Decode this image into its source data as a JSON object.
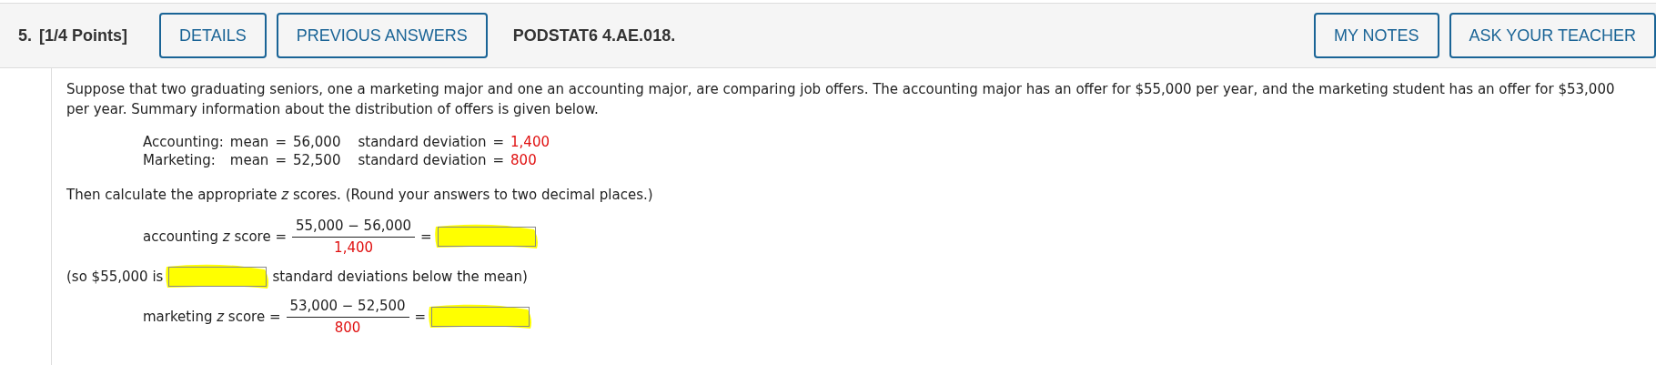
{
  "header": {
    "number": "5.",
    "points": "[1/4 Points]",
    "left_buttons": [
      {
        "label": "DETAILS"
      },
      {
        "label": "PREVIOUS ANSWERS"
      }
    ],
    "code": "PODSTAT6 4.AE.018.",
    "right_buttons": [
      {
        "label": "MY NOTES"
      },
      {
        "label": "ASK YOUR TEACHER"
      }
    ]
  },
  "intro": "Suppose that two graduating seniors, one a marketing major and one an accounting major, are comparing job offers. The accounting major has an offer for $55,000 per year, and the marketing student has an offer for $53,000 per year. Summary information about the distribution of offers is given below.",
  "stats": [
    {
      "label": "Accounting:",
      "mean_label": "mean",
      "mean_eq": "=",
      "mean": "56,000",
      "sd_label": "standard deviation",
      "sd_eq": "=",
      "sd": "1,400"
    },
    {
      "label": "Marketing:",
      "mean_label": "mean",
      "mean_eq": "=",
      "mean": "52,500",
      "sd_label": "standard deviation",
      "sd_eq": "=",
      "sd": "800"
    }
  ],
  "instruction": "Then calculate the appropriate *z* scores. (Round your answers to two decimal places.)",
  "parts": [
    {
      "kind": "equation",
      "label": "accounting *z* score =",
      "numerator": "55,000 − 56,000",
      "denominator": "1,400",
      "equals": "=",
      "highlighted": true
    },
    {
      "kind": "sentence",
      "before": "(so $55,000 is",
      "after": "standard deviations below the mean)",
      "highlighted": true
    },
    {
      "kind": "equation",
      "label": "marketing *z* score =",
      "numerator": "53,000 − 52,500",
      "denominator": "800",
      "equals": "=",
      "highlighted": true
    }
  ]
}
